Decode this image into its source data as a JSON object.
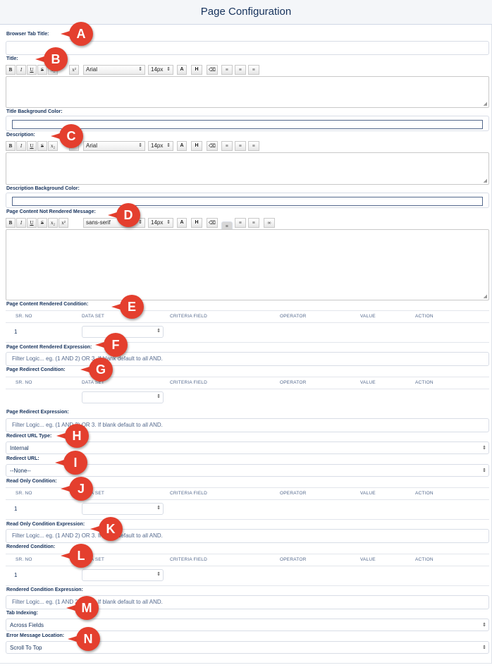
{
  "header": {
    "title": "Page Configuration"
  },
  "labels": {
    "browser_tab_title": "Browser Tab Title:",
    "title": "Title:",
    "title_bg": "Title Background Color:",
    "description": "Description:",
    "description_bg": "Description Background Color:",
    "not_rendered_msg": "Page Content Not Rendered Message:",
    "rendered_condition": "Page Content Rendered Condition:",
    "rendered_expression": "Page Content Rendered Expression:",
    "redirect_condition": "Page Redirect Condition:",
    "redirect_expression": "Page Redirect Expression:",
    "redirect_url_type": "Redirect URL Type:",
    "redirect_url": "Redirect URL:",
    "read_only_condition": "Read Only Condition:",
    "read_only_expression": "Read Only Condition Expression:",
    "rendered_cond": "Rendered Condition:",
    "rendered_cond_expression": "Rendered Condition Expression:",
    "tab_indexing": "Tab Indexing:",
    "error_location": "Error Message Location:"
  },
  "toolbar": {
    "bold": "B",
    "italic": "I",
    "underline": "U",
    "strike": "S",
    "subscript": "x₂",
    "superscript": "x²",
    "font1": "Arial",
    "font2": "Arial",
    "font3": "sans-serif",
    "size": "14px",
    "larger": "A",
    "heading": "H"
  },
  "table": {
    "columns": [
      "SR. NO",
      "DATA SET",
      "CRITERIA FIELD",
      "OPERATOR",
      "VALUE",
      "ACTION"
    ],
    "row_no": "1"
  },
  "expressions": {
    "placeholder": "Filter Logic... eg. (1 AND 2) OR 3. If blank default to all AND."
  },
  "selects": {
    "redirect_url_type": "Internal",
    "redirect_url": "--None--",
    "tab_indexing": "Across Fields",
    "error_location": "Scroll To Top"
  },
  "callouts": [
    "A",
    "B",
    "C",
    "D",
    "E",
    "F",
    "G",
    "H",
    "I",
    "J",
    "K",
    "L",
    "M",
    "N"
  ],
  "colors": {
    "accent": "#16325c",
    "callout": "#e43f2e",
    "border": "#d8dde6"
  }
}
